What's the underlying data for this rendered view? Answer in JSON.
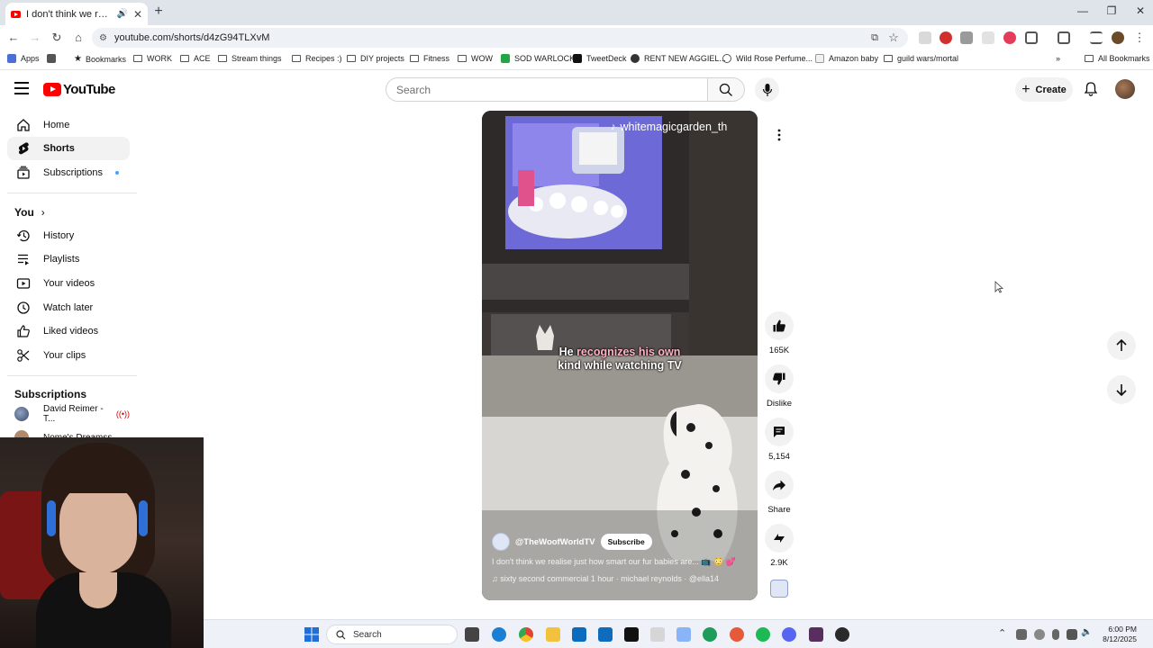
{
  "browser": {
    "tab_title": "I don't think we realise just how smart our fur babies are",
    "new_tab": "+",
    "url": "youtube.com/shorts/d4zG94TLXvM",
    "bookmarks": [
      "Apps",
      "Bookmarks",
      "WORK",
      "ACE",
      "Stream things",
      "Recipes :)",
      "DIY projects",
      "Fitness",
      "WOW",
      "SOD WARLOCK",
      "TweetDeck",
      "RENT NEW AGGIEL...",
      "Wild Rose Perfume...",
      "Amazon baby",
      "guild wars/mortal"
    ],
    "all_bookmarks": "All Bookmarks"
  },
  "masthead": {
    "logo_text": "YouTube",
    "search_placeholder": "Search",
    "create_label": "Create"
  },
  "sidebar": {
    "items": [
      {
        "label": "Home",
        "icon": "home-icon"
      },
      {
        "label": "Shorts",
        "icon": "shorts-icon"
      },
      {
        "label": "Subscriptions",
        "icon": "subscriptions-icon"
      }
    ],
    "you_heading": "You",
    "you_items": [
      {
        "label": "History",
        "icon": "history-icon"
      },
      {
        "label": "Playlists",
        "icon": "playlists-icon"
      },
      {
        "label": "Your videos",
        "icon": "your-videos-icon"
      },
      {
        "label": "Watch later",
        "icon": "watch-later-icon"
      },
      {
        "label": "Liked videos",
        "icon": "liked-videos-icon"
      },
      {
        "label": "Your clips",
        "icon": "clips-icon"
      }
    ],
    "subscriptions_heading": "Subscriptions",
    "subscriptions": [
      {
        "name": "David Reimer - T..."
      },
      {
        "name": "Nome's Dreamss..."
      }
    ]
  },
  "short": {
    "watermark_handle": "whitemagicgarden_th",
    "caption_line1_a": "He ",
    "caption_line1_b": "recognizes his own",
    "caption_line2": "kind while watching TV",
    "channel": "@TheWoofWorldTV",
    "subscribe_label": "Subscribe",
    "description": "I don't think we realise just how smart our fur babies are... 📺 😳 💕",
    "music": "♫ sixty second commercial 1 hour · michael reynolds · @ella14"
  },
  "actions": {
    "likes": "165K",
    "dislike": "Dislike",
    "comments": "5,154",
    "share": "Share",
    "remix": "2.9K"
  },
  "taskbar": {
    "search": "Search",
    "time": "6:00 PM",
    "date": "8/12/2025"
  },
  "colors": {
    "youtube_red": "#ff0000",
    "chip_bg": "#f2f2f2",
    "text": "#0f0f0f"
  }
}
